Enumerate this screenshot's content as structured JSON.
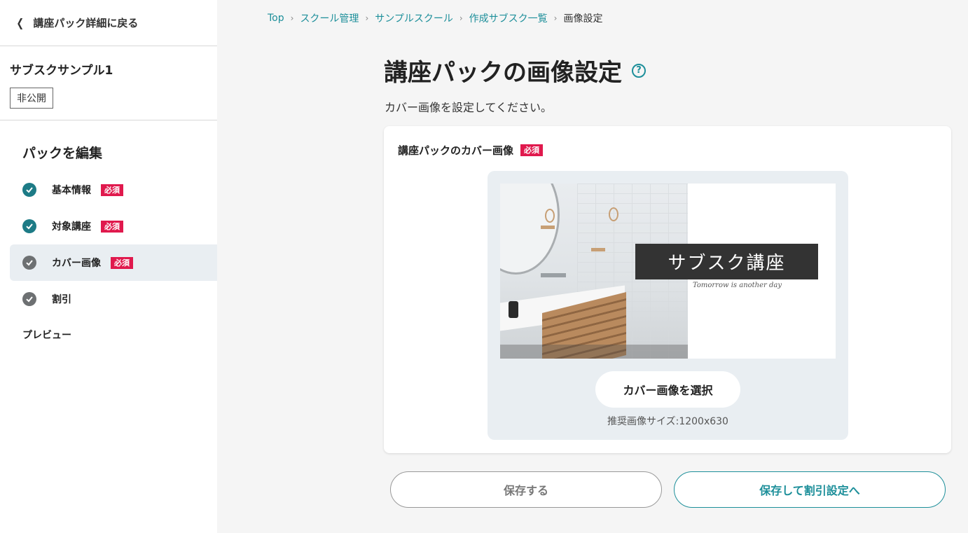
{
  "sidebar": {
    "back_label": "講座パック詳細に戻る",
    "pack_name": "サブスクサンプル1",
    "status": "非公開",
    "edit_title": "パックを編集",
    "required_label": "必須",
    "items": [
      {
        "label": "基本情報",
        "required": true,
        "state": "done"
      },
      {
        "label": "対象講座",
        "required": true,
        "state": "done"
      },
      {
        "label": "カバー画像",
        "required": true,
        "state": "current"
      },
      {
        "label": "割引",
        "required": false,
        "state": "pending"
      }
    ],
    "preview_label": "プレビュー"
  },
  "breadcrumb": {
    "items": [
      "Top",
      "スクール管理",
      "サンプルスクール",
      "作成サブスク一覧",
      "画像設定"
    ]
  },
  "main": {
    "title": "講座パックの画像設定",
    "help_glyph": "?",
    "description": "カバー画像を設定してください。",
    "card": {
      "label": "講座パックのカバー画像",
      "required_label": "必須",
      "cover": {
        "banner_text": "サブスク講座",
        "tagline": "Tomorrow is another day"
      },
      "select_button": "カバー画像を選択",
      "size_note": "推奨画像サイズ:1200x630"
    },
    "save_button": "保存する",
    "save_next_button": "保存して割引設定へ"
  },
  "colors": {
    "accent": "#1d8f9a",
    "check_done": "#1d7b86",
    "check_pending": "#6d7072",
    "required_badge": "#e0194d",
    "active_item_bg": "#e9eef2"
  },
  "icons": {
    "back": "chevron-left-icon",
    "help": "question-circle-icon",
    "step_done": "check-circle-icon"
  }
}
